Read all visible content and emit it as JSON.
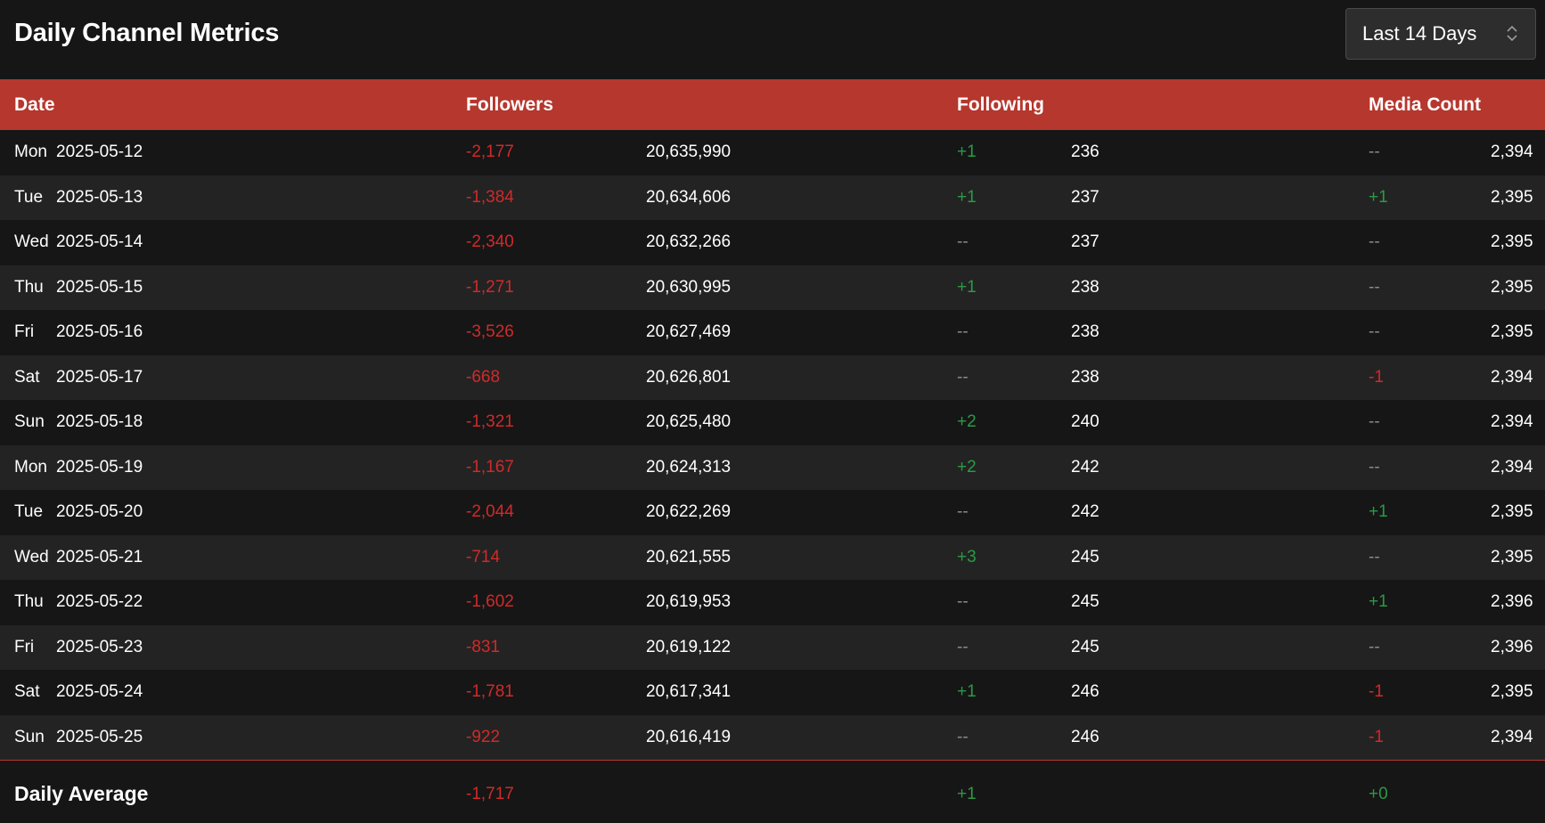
{
  "page": {
    "title": "Daily Channel Metrics",
    "range_selector": {
      "value": "Last 14 Days"
    }
  },
  "colors": {
    "header_bg": "#b5372e",
    "negative": "#d02a2a",
    "positive": "#2a9a46",
    "neutral": "#8a8a8a",
    "background": "#161616",
    "row_alt": "#232323"
  },
  "table": {
    "headers": {
      "date": "Date",
      "followers": "Followers",
      "following": "Following",
      "media": "Media Count"
    },
    "rows": [
      {
        "day": "Mon",
        "date": "2025-05-12",
        "followers_delta": "-2,177",
        "followers": "20,635,990",
        "following_delta": "+1",
        "following": "236",
        "media_delta": "--",
        "media": "2,394"
      },
      {
        "day": "Tue",
        "date": "2025-05-13",
        "followers_delta": "-1,384",
        "followers": "20,634,606",
        "following_delta": "+1",
        "following": "237",
        "media_delta": "+1",
        "media": "2,395"
      },
      {
        "day": "Wed",
        "date": "2025-05-14",
        "followers_delta": "-2,340",
        "followers": "20,632,266",
        "following_delta": "--",
        "following": "237",
        "media_delta": "--",
        "media": "2,395"
      },
      {
        "day": "Thu",
        "date": "2025-05-15",
        "followers_delta": "-1,271",
        "followers": "20,630,995",
        "following_delta": "+1",
        "following": "238",
        "media_delta": "--",
        "media": "2,395"
      },
      {
        "day": "Fri",
        "date": "2025-05-16",
        "followers_delta": "-3,526",
        "followers": "20,627,469",
        "following_delta": "--",
        "following": "238",
        "media_delta": "--",
        "media": "2,395"
      },
      {
        "day": "Sat",
        "date": "2025-05-17",
        "followers_delta": "-668",
        "followers": "20,626,801",
        "following_delta": "--",
        "following": "238",
        "media_delta": "-1",
        "media": "2,394"
      },
      {
        "day": "Sun",
        "date": "2025-05-18",
        "followers_delta": "-1,321",
        "followers": "20,625,480",
        "following_delta": "+2",
        "following": "240",
        "media_delta": "--",
        "media": "2,394"
      },
      {
        "day": "Mon",
        "date": "2025-05-19",
        "followers_delta": "-1,167",
        "followers": "20,624,313",
        "following_delta": "+2",
        "following": "242",
        "media_delta": "--",
        "media": "2,394"
      },
      {
        "day": "Tue",
        "date": "2025-05-20",
        "followers_delta": "-2,044",
        "followers": "20,622,269",
        "following_delta": "--",
        "following": "242",
        "media_delta": "+1",
        "media": "2,395"
      },
      {
        "day": "Wed",
        "date": "2025-05-21",
        "followers_delta": "-714",
        "followers": "20,621,555",
        "following_delta": "+3",
        "following": "245",
        "media_delta": "--",
        "media": "2,395"
      },
      {
        "day": "Thu",
        "date": "2025-05-22",
        "followers_delta": "-1,602",
        "followers": "20,619,953",
        "following_delta": "--",
        "following": "245",
        "media_delta": "+1",
        "media": "2,396"
      },
      {
        "day": "Fri",
        "date": "2025-05-23",
        "followers_delta": "-831",
        "followers": "20,619,122",
        "following_delta": "--",
        "following": "245",
        "media_delta": "--",
        "media": "2,396"
      },
      {
        "day": "Sat",
        "date": "2025-05-24",
        "followers_delta": "-1,781",
        "followers": "20,617,341",
        "following_delta": "+1",
        "following": "246",
        "media_delta": "-1",
        "media": "2,395"
      },
      {
        "day": "Sun",
        "date": "2025-05-25",
        "followers_delta": "-922",
        "followers": "20,616,419",
        "following_delta": "--",
        "following": "246",
        "media_delta": "-1",
        "media": "2,394"
      }
    ],
    "footer": {
      "label": "Daily Average",
      "followers_delta": "-1,717",
      "following_delta": "+1",
      "media_delta": "+0"
    }
  }
}
